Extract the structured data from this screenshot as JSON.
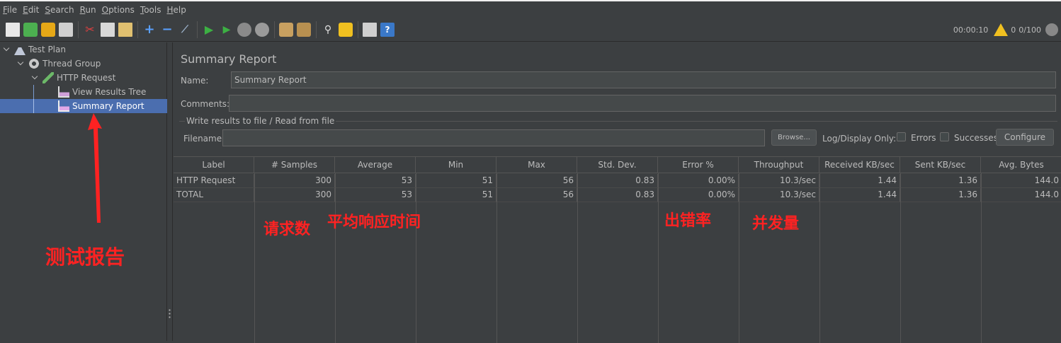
{
  "menu": [
    {
      "key": "F",
      "rest": "ile"
    },
    {
      "key": "E",
      "rest": "dit"
    },
    {
      "key": "S",
      "rest": "earch"
    },
    {
      "key": "R",
      "rest": "un"
    },
    {
      "key": "O",
      "rest": "ptions"
    },
    {
      "key": "T",
      "rest": "ools"
    },
    {
      "key": "H",
      "rest": "elp"
    }
  ],
  "status": {
    "timer": "00:00:10",
    "warnings": "0",
    "threads": "0/100"
  },
  "tree": {
    "test_plan": "Test Plan",
    "thread_group": "Thread Group",
    "http_request": "HTTP Request",
    "view_results_tree": "View Results Tree",
    "summary_report": "Summary Report"
  },
  "panel": {
    "title": "Summary Report",
    "name_label": "Name:",
    "name_value": "Summary Report",
    "comments_label": "Comments:",
    "comments_value": "",
    "fieldset_legend": "Write results to file / Read from file",
    "filename_label": "Filename",
    "filename_value": "",
    "browse_label": "Browse...",
    "log_display_label": "Log/Display Only:",
    "errors_label": "Errors",
    "successes_label": "Successes",
    "configure_label": "Configure"
  },
  "table": {
    "headers": [
      "Label",
      "# Samples",
      "Average",
      "Min",
      "Max",
      "Std. Dev.",
      "Error %",
      "Throughput",
      "Received KB/sec",
      "Sent KB/sec",
      "Avg. Bytes"
    ],
    "rows": [
      [
        "HTTP Request",
        "300",
        "53",
        "51",
        "56",
        "0.83",
        "0.00%",
        "10.3/sec",
        "1.44",
        "1.36",
        "144.0"
      ],
      [
        "TOTAL",
        "300",
        "53",
        "51",
        "56",
        "0.83",
        "0.00%",
        "10.3/sec",
        "1.44",
        "1.36",
        "144.0"
      ]
    ]
  },
  "annotations": {
    "test_report": "测试报告",
    "requests": "请求数",
    "avg_response_time": "平均响应时间",
    "error_rate": "出错率",
    "concurrency": "并发量"
  },
  "colors": {
    "annotation": "#ff2222",
    "selection": "#4b6eaf",
    "background": "#3c3f41"
  }
}
